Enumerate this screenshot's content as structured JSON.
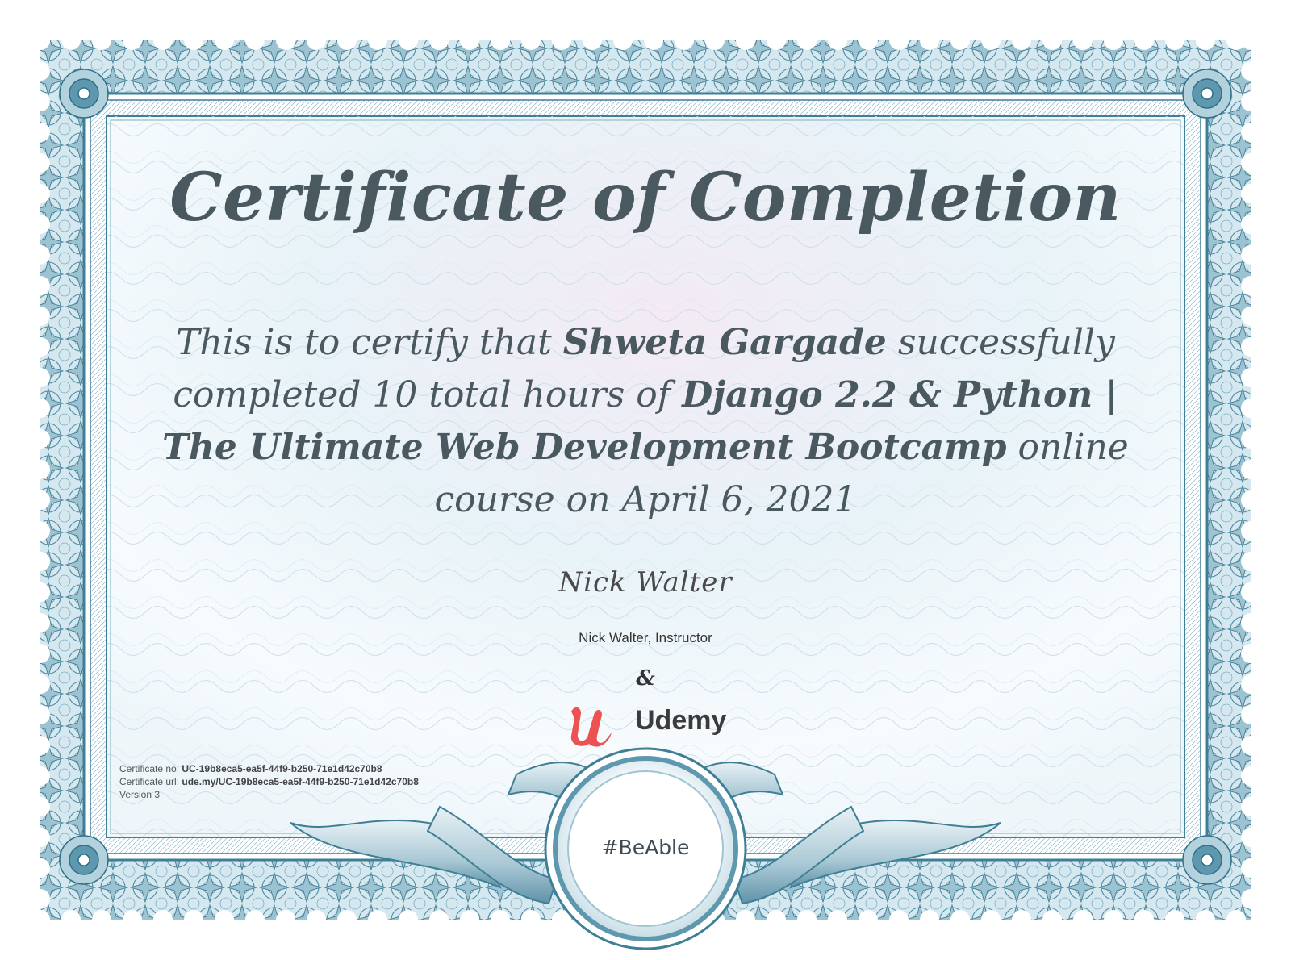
{
  "certificate": {
    "title": "Certificate of Completion",
    "body": {
      "lead": "This is to certify that",
      "recipient": "Shweta Gargade",
      "mid": "successfully completed 10 total hours of",
      "course": "Django 2.2 & Python | The Ultimate Web Development Bootcamp",
      "tail": "online course on April 6, 2021"
    },
    "signature": {
      "handwritten": "Nick Walter",
      "caption": "Nick Walter, Instructor"
    },
    "ampersand": "&",
    "brand": {
      "name": "Udemy",
      "logo_color": "#ec5252",
      "wordmark_color": "#3b3b3b"
    },
    "meta": {
      "number_label": "Certificate no:",
      "number_value": "UC-19b8eca5-ea5f-44f9-b250-71e1d42c70b8",
      "url_label": "Certificate url:",
      "url_value": "ude.my/UC-19b8eca5-ea5f-44f9-b250-71e1d42c70b8",
      "version": "Version 3"
    },
    "badge": "#BeAble",
    "colors": {
      "frame": "#3f7f96",
      "frame_light": "#a8cbd8",
      "text": "#4a5860",
      "paper": "#e7f3f8"
    }
  }
}
